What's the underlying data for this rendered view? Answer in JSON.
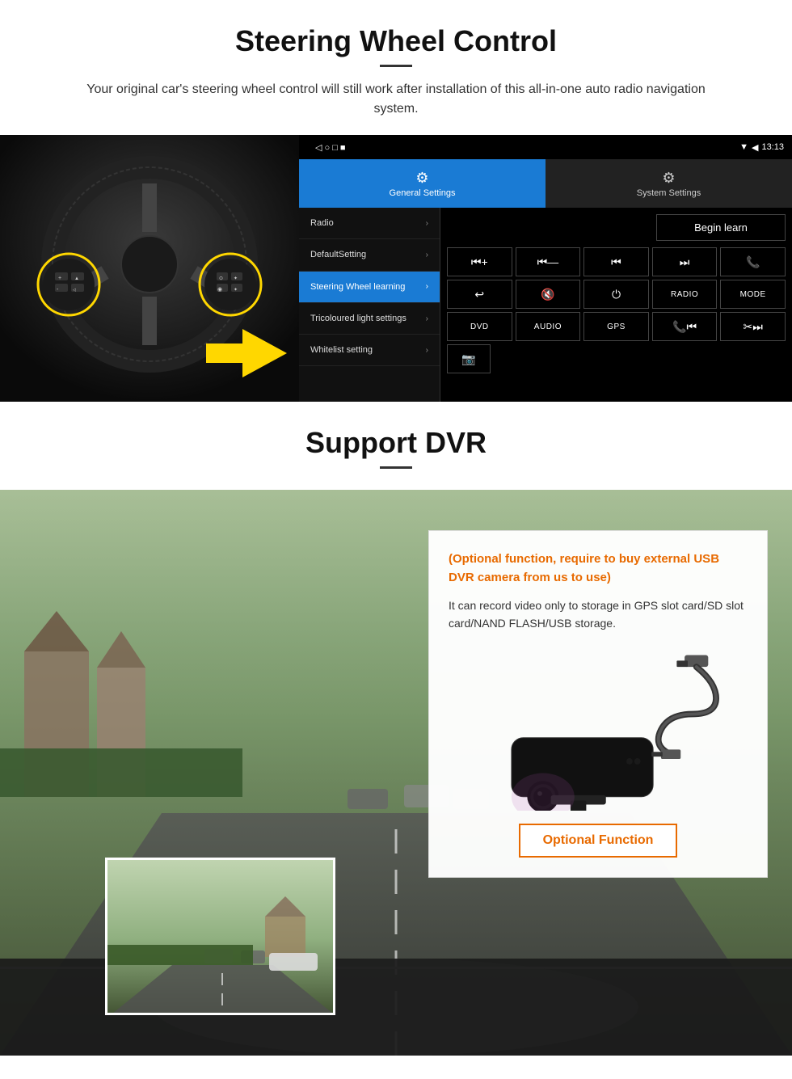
{
  "steering_section": {
    "title": "Steering Wheel Control",
    "subtitle": "Your original car's steering wheel control will still work after installation of this all-in-one auto radio navigation system.",
    "android": {
      "statusbar": {
        "time": "13:13",
        "icons": "▼ ◀"
      },
      "tabs": [
        {
          "id": "general",
          "label": "General Settings",
          "active": true
        },
        {
          "id": "system",
          "label": "System Settings",
          "active": false
        }
      ],
      "menu_items": [
        {
          "label": "Radio",
          "active": false
        },
        {
          "label": "DefaultSetting",
          "active": false
        },
        {
          "label": "Steering Wheel learning",
          "active": true
        },
        {
          "label": "Tricoloured light settings",
          "active": false
        },
        {
          "label": "Whitelist setting",
          "active": false
        }
      ],
      "begin_learn": "Begin learn",
      "control_buttons_row1": [
        "▐◀+",
        "▐◀—",
        "◀◀",
        "▶▶",
        "📞"
      ],
      "control_buttons_row2": [
        "↩",
        "🔇",
        "⏻",
        "RADIO",
        "MODE"
      ],
      "control_buttons_row3": [
        "DVD",
        "AUDIO",
        "GPS",
        "📞◀◀",
        "✂▶▶"
      ],
      "control_buttons_row4": [
        "📷"
      ]
    }
  },
  "dvr_section": {
    "title": "Support DVR",
    "optional_text": "(Optional function, require to buy external USB DVR camera from us to use)",
    "description": "It can record video only to storage in GPS slot card/SD slot card/NAND FLASH/USB storage.",
    "optional_function_label": "Optional Function"
  }
}
